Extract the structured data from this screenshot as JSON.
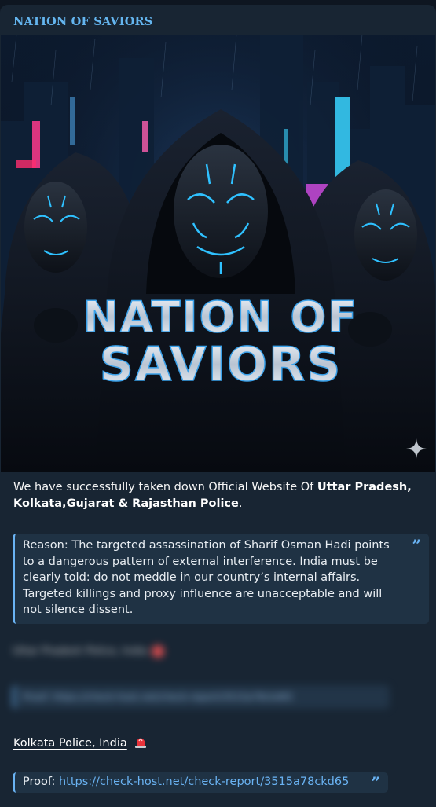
{
  "channel": {
    "name": "NATION OF SAVIORS"
  },
  "photo": {
    "caption_line1": "NATION OF",
    "caption_line2": "SAVIORS",
    "sparkle_icon": "sparkle-icon"
  },
  "message": {
    "intro_plain": "We have successfully taken down Official Website Of ",
    "intro_bold": "Uttar Pradesh, Kolkata,Gujarat & Rajasthan Police",
    "intro_end": ".",
    "reason_quote": "Reason: The targeted assassination of Sharif Osman Hadi points to a dangerous pattern of external interference. India must be clearly told: do not meddle in our country’s internal affairs. Targeted killings and proxy influence are unacceptable and will not silence dissent.",
    "blurred_line1": "Uttar Pradesh Police, India",
    "blurred_line2": "Proof: https://check-host.net/check-report/3515a78ckd65",
    "kolkata_label": "Kolkata Police, India",
    "proof_label": "Proof:",
    "proof_url": "https://check-host.net/check-report/3515a78ckd65"
  },
  "colors": {
    "background": "#0e1621",
    "bubble": "#182533",
    "accent": "#6ab3f3",
    "sender_name": "#64b5ef"
  }
}
